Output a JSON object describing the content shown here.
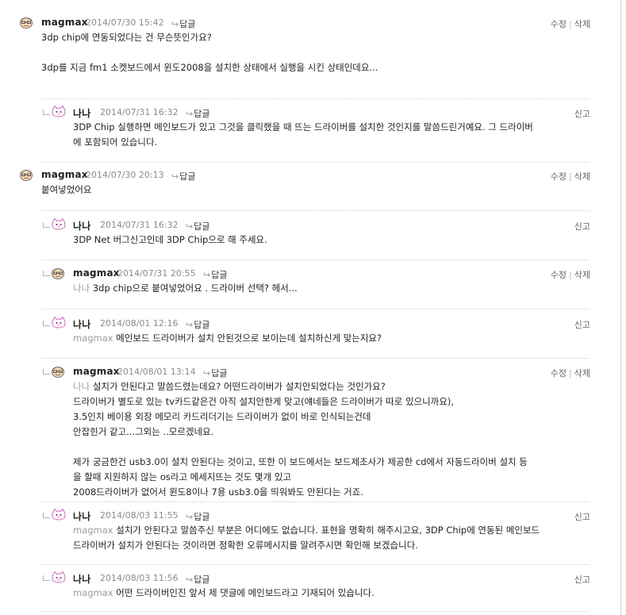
{
  "labels": {
    "reply": "답글",
    "edit": "수정",
    "delete": "삭제",
    "report": "신고",
    "sep": "|"
  },
  "comments": [
    {
      "author": "magmax",
      "date": "2014/07/30 15:42",
      "lines": [
        "3dp chip에 연동되었다는 건 무슨뜻인가요?",
        "",
        "3dp를 지금 fm1 소켓보드에서 윈도2008을 설치한 상태에서 실행을 시킨 상태인데요..."
      ]
    },
    {
      "author": "나나",
      "date": "2014/07/31 16:32",
      "lines": [
        "3DP Chip 실행하면 메인보드가 있고 그것을 클릭했을 때 뜨는 드라이버를 설치한 것인지를 말씀드린거예요. 그 드라이버",
        "에 포함되어 있습니다."
      ]
    },
    {
      "author": "magmax",
      "date": "2014/07/30 20:13",
      "lines": [
        "붙여넣었어요"
      ]
    },
    {
      "author": "나나",
      "date": "2014/07/31 16:32",
      "lines": [
        "3DP Net 버그신고인데 3DP Chip으로 해 주세요."
      ]
    },
    {
      "author": "magmax",
      "date": "2014/07/31 20:55",
      "tag": "나나",
      "lines": [
        "3dp chip으로 붙여넣었어요 . 드라이버 선택? 헤서..."
      ]
    },
    {
      "author": "나나",
      "date": "2014/08/01 12:16",
      "tag": "magmax",
      "lines": [
        "메인보드 드라이버가 설치 안된것으로 보이는데 설치하신게 맞는지요?"
      ]
    },
    {
      "author": "magmax",
      "date": "2014/08/01 13:14",
      "tag": "나나",
      "lines": [
        "설치가 안된다고 말씀드렸는데요? 어떤드라이버가 설치안되었다는 것인가요?",
        "드라이버가 별도로 있는 tv카드같은건 아직 설치안한게 맞고(얘네들은 드라이버가 따로 있으니까요),",
        "3.5인치 베이용 외장 메모리 카드리더기는 드라이버가 없이 바로 인식되는건데",
        "안잡힌거 같고...그외는 ..모르겠네요.",
        "",
        "제가 궁금한건 usb3.0이 설치 안된다는 것이고, 또한 이 보드에서는 보드제조사가 제공한 cd에서 자동드라이버 설치 등",
        "을 할때 지원하지 않는 os라고 메세지뜨는 것도 몇개 있고",
        "2008드라이버가 없어서 윈도8이나 7용 usb3.0을 띄워봐도 안된다는 거죠."
      ]
    },
    {
      "author": "나나",
      "date": "2014/08/03 11:55",
      "tag": "magmax",
      "lines": [
        "설치가 안된다고 말씀주신 부분은 어디에도 없습니다. 표현을 명확히 해주시고요, 3DP Chip에 연동된 메인보드",
        "드라이버가 설치가 안된다는 것이라면 정확한 오류메시지를 알려주시면 확인해 보겠습니다."
      ]
    },
    {
      "author": "나나",
      "date": "2014/08/03 11:56",
      "tag": "magmax",
      "lines": [
        "어떤 드라이버인진 앞서 제 댓글에 메인보드라고 기재되어 있습니다."
      ]
    }
  ]
}
